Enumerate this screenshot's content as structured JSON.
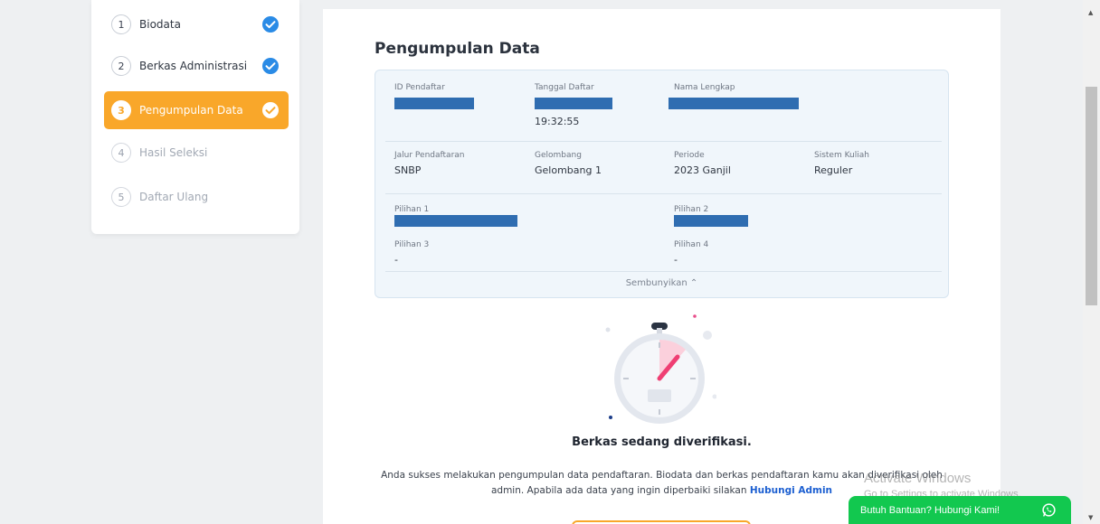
{
  "stepper": {
    "steps": [
      {
        "number": "1",
        "label": "Biodata",
        "state": "done"
      },
      {
        "number": "2",
        "label": "Berkas Administrasi",
        "state": "done"
      },
      {
        "number": "3",
        "label": "Pengumpulan Data",
        "state": "active"
      },
      {
        "number": "4",
        "label": "Hasil Seleksi",
        "state": "pending"
      },
      {
        "number": "5",
        "label": "Daftar Ulang",
        "state": "pending"
      }
    ]
  },
  "main": {
    "title": "Pengumpulan Data",
    "info": {
      "id_label": "ID Pendaftar",
      "date_label": "Tanggal Daftar",
      "date_time": "19:32:55",
      "name_label": "Nama Lengkap",
      "jalur_label": "Jalur Pendaftaran",
      "jalur_value": "SNBP",
      "gelombang_label": "Gelombang",
      "gelombang_value": "Gelombang 1",
      "periode_label": "Periode",
      "periode_value": "2023 Ganjil",
      "sistem_label": "Sistem Kuliah",
      "sistem_value": "Reguler",
      "pilihan1_label": "Pilihan 1",
      "pilihan2_label": "Pilihan 2",
      "pilihan3_label": "Pilihan 3",
      "pilihan3_value": "-",
      "pilihan4_label": "Pilihan 4",
      "pilihan4_value": "-",
      "toggle_label": "Sembunyikan ⌃"
    },
    "status_title": "Berkas sedang diverifikasi.",
    "status_desc_part1": "Anda sukses melakukan pengumpulan data pendaftaran. Biodata dan berkas pendaftaran kamu akan diverifikasi oleh admin. Apabila ada data yang ingin diperbaiki silakan ",
    "status_desc_link": "Hubungi Admin"
  },
  "watermark": {
    "line1": "Activate Windows",
    "line2": "Go to Settings to activate Windows."
  },
  "help": {
    "label": "Butuh Bantuan? Hubungi Kami!"
  },
  "colors": {
    "accent": "#f9a72a",
    "check": "#2a8be6",
    "redaction": "#2f6db1",
    "whatsapp": "#12c84f",
    "link": "#1c5fd1"
  },
  "icons": {
    "done": "check-circle-icon",
    "active": "check-circle-outline-icon",
    "help": "whatsapp-icon",
    "status": "stopwatch-icon"
  }
}
